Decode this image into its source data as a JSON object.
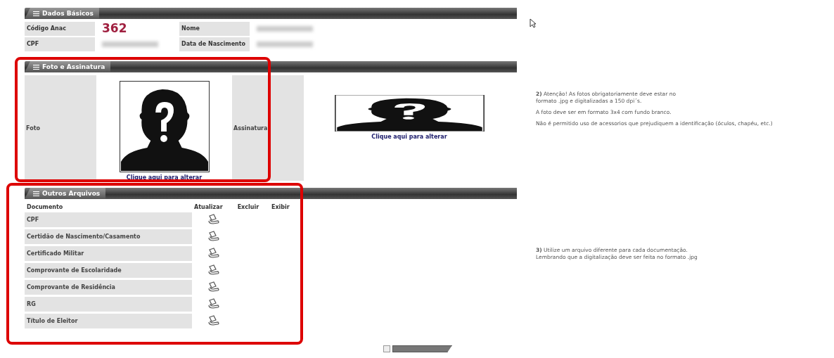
{
  "sections": [
    {
      "kind": "basic",
      "title": "Dados Básicos",
      "fields": [
        {
          "label": "Código Anac",
          "value": "362"
        },
        {
          "label": "Nome"
        },
        {
          "label": "CPF"
        },
        {
          "label": "Data de Nascimento"
        }
      ]
    },
    {
      "kind": "photo",
      "title": "Foto e Assinatura",
      "highlighted": true,
      "photo_label": "Foto",
      "photo_caption": "Clique aqui para alterar",
      "signature_label": "Assinatura",
      "signature_caption": "Clique aqui para alterar",
      "notes": [
        "**2)** Atenção! As fotos obrigatoriamente deve estar no\nformato .jpg e digitalizadas a 150 dpi´s.",
        "A foto deve ser em formato 3x4 com fundo branco.",
        "Não é permitido uso de acessorios que prejudiquem a identificação (óculos, chapéu, etc.)"
      ]
    },
    {
      "kind": "files",
      "title": "Outros Arquivos",
      "highlighted": true,
      "columns": [
        "Documento",
        "Atualizar",
        "Excluir",
        "Exibir"
      ],
      "rows": [
        "CPF",
        "Certidão de Nascimento/Casamento",
        "Certificado Militar",
        "Comprovante de Escolaridade",
        "Comprovante de Residência",
        "RG",
        "Título de Eleitor"
      ],
      "notes": [
        "**3)** Utilize um arquivo diferente para cada documentação.\nLembrando que a digitalização deve ser feita no formato .jpg"
      ]
    }
  ]
}
